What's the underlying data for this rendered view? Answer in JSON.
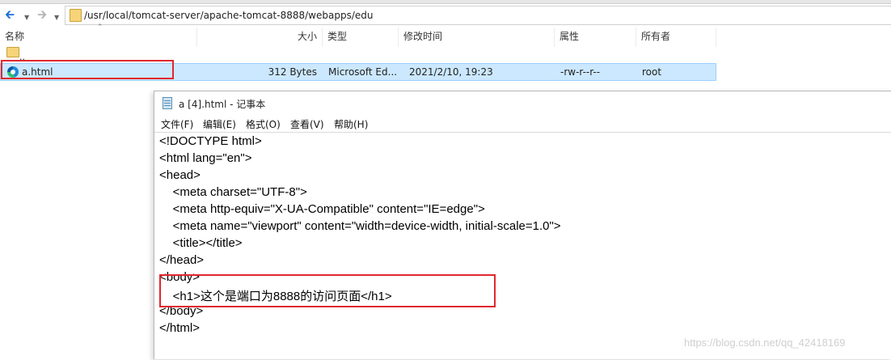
{
  "explorer": {
    "path": "/usr/local/tomcat-server/apache-tomcat-8888/webapps/edu",
    "columns": {
      "name": "名称",
      "size": "大小",
      "type": "类型",
      "modified": "修改时间",
      "attributes": "属性",
      "owner": "所有者"
    },
    "parent_label": "..",
    "file": {
      "name": "a.html",
      "size": "312 Bytes",
      "type": "Microsoft Ed...",
      "modified": "2021/2/10, 19:23",
      "attributes": "-rw-r--r--",
      "owner": "root"
    }
  },
  "notepad": {
    "title": "a [4].html - 记事本",
    "menu": [
      "文件(F)",
      "编辑(E)",
      "格式(O)",
      "查看(V)",
      "帮助(H)"
    ],
    "lines": [
      "<!DOCTYPE html>",
      "<html lang=\"en\">",
      "<head>",
      "    <meta charset=\"UTF-8\">",
      "    <meta http-equiv=\"X-UA-Compatible\" content=\"IE=edge\">",
      "    <meta name=\"viewport\" content=\"width=device-width, initial-scale=1.0\">",
      "    <title></title>",
      "</head>",
      "<body>",
      "    <h1>这个是端口为8888的访问页面</h1>",
      "</body>",
      "</html>"
    ]
  },
  "watermark": "https://blog.csdn.net/qq_42418169",
  "colors": {
    "highlight": "#e0282e",
    "selection": "#cce8ff"
  }
}
